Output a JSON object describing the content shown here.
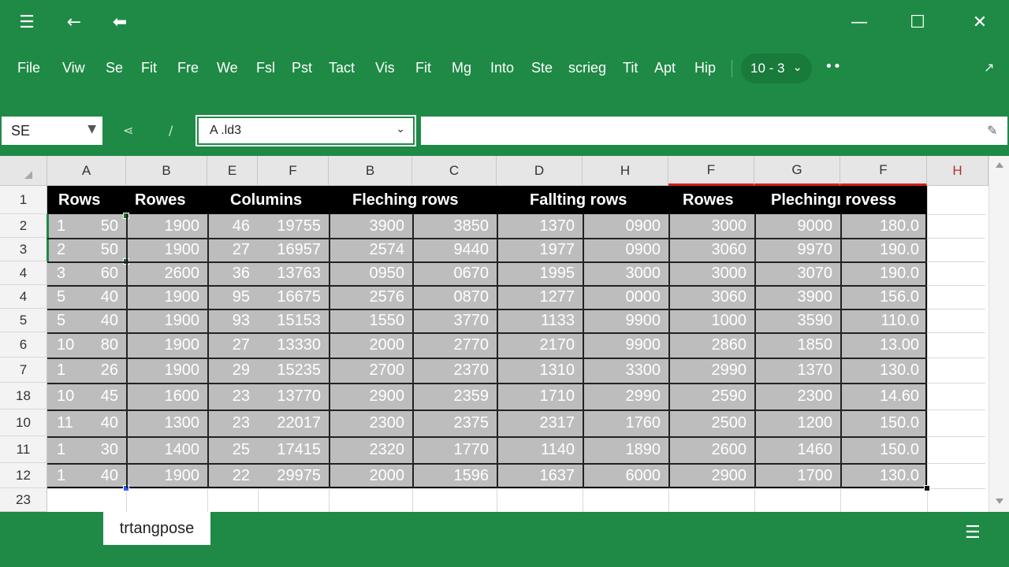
{
  "titlebar": {
    "menu_icon": "hamburger-icon",
    "back_icon": "back-arrow-icon",
    "back_bold_icon": "back-arrow-bold-icon",
    "minimize_icon": "minimize-icon",
    "maximize_icon": "maximize-icon",
    "close_icon": "close-icon"
  },
  "menu": [
    "File",
    "Viw",
    "Se",
    "Fit",
    "Fre",
    "We",
    "Fsl",
    "Pst",
    "Tact",
    "Vis",
    "Fit",
    "Mg",
    "Into",
    "Ste",
    "scrieg",
    "Tit",
    "Apt",
    "Hip"
  ],
  "zoom": {
    "label": "10 - 3"
  },
  "formula_bar": {
    "name_box": "SE",
    "function_box": "A .ld3",
    "formula_value": ""
  },
  "columns": [
    "A",
    "B",
    "E",
    "F",
    "B",
    "C",
    "D",
    "H",
    "F",
    "G",
    "F",
    "H"
  ],
  "rows": [
    "1",
    "2",
    "3",
    "4",
    "4",
    "5",
    "6",
    "7",
    "18",
    "10",
    "11",
    "12",
    "23"
  ],
  "table_header": [
    "Rows",
    "Rowes",
    "Columins",
    "Fleching rows",
    "Fallting rows",
    "Rowes",
    "Plechingı rovess"
  ],
  "table_rows": [
    [
      "1",
      "50",
      "1900",
      "46",
      "19755",
      "3900",
      "3850",
      "1370",
      "0900",
      "3000",
      "9000",
      "180.0"
    ],
    [
      "2",
      "50",
      "1900",
      "27",
      "16957",
      "2574",
      "9440",
      "1977",
      "0900",
      "3060",
      "9970",
      "190.0"
    ],
    [
      "3",
      "60",
      "2600",
      "36",
      "13763",
      "0950",
      "0670",
      "1995",
      "3000",
      "3000",
      "3070",
      "190.0"
    ],
    [
      "5",
      "40",
      "1900",
      "95",
      "16675",
      "2576",
      "0870",
      "1277",
      "0000",
      "3060",
      "3900",
      "156.0"
    ],
    [
      "5",
      "40",
      "1900",
      "93",
      "15153",
      "1550",
      "3770",
      "1133",
      "9900",
      "1000",
      "3590",
      "110.0"
    ],
    [
      "10",
      "80",
      "1900",
      "27",
      "13330",
      "2000",
      "2770",
      "2170",
      "9900",
      "2860",
      "1850",
      "13.00"
    ],
    [
      "1",
      "26",
      "1900",
      "29",
      "15235",
      "2700",
      "2370",
      "1310",
      "3300",
      "2990",
      "1370",
      "130.0"
    ],
    [
      "10",
      "45",
      "1600",
      "23",
      "13770",
      "2900",
      "2359",
      "1710",
      "2990",
      "2590",
      "2300",
      "14.60"
    ],
    [
      "11",
      "40",
      "1300",
      "23",
      "22017",
      "2300",
      "2375",
      "2317",
      "1760",
      "2500",
      "1200",
      "150.0"
    ],
    [
      "1",
      "30",
      "1400",
      "25",
      "17415",
      "2320",
      "1770",
      "1140",
      "1890",
      "2600",
      "1460",
      "150.0"
    ],
    [
      "1",
      "40",
      "1900",
      "22",
      "29975",
      "2000",
      "1596",
      "1637",
      "6000",
      "2900",
      "1700",
      "130.0"
    ]
  ],
  "sheet_tab": "trtangpose",
  "colors": {
    "accent": "#1e8a45",
    "data_fill": "#bdbdbd",
    "header_fill": "#000000",
    "highlight_underline": "#d02020"
  }
}
